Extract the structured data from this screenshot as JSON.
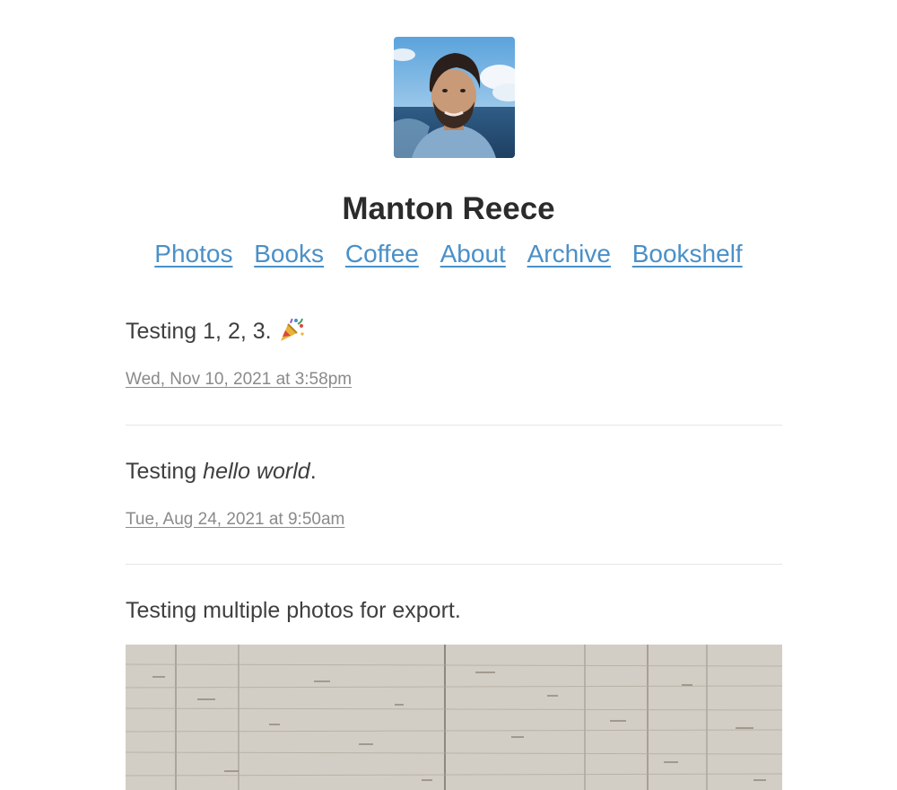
{
  "site": {
    "title": "Manton Reece",
    "avatar_icon": "avatar-photo"
  },
  "nav": {
    "items": [
      {
        "label": "Photos"
      },
      {
        "label": "Books"
      },
      {
        "label": "Coffee"
      },
      {
        "label": "About"
      },
      {
        "label": "Archive"
      },
      {
        "label": "Bookshelf"
      }
    ]
  },
  "colors": {
    "link": "#4a90c8",
    "text": "#3f3f3f",
    "date": "#8a8a8a",
    "divider": "#e6e6e6"
  },
  "posts": [
    {
      "text": "Testing 1, 2, 3.",
      "emoji_icon": "party-popper-icon",
      "date": "Wed, Nov 10, 2021 at 3:58pm"
    },
    {
      "text_prefix": "Testing ",
      "text_em": "hello world",
      "text_suffix": ".",
      "date": "Tue, Aug 24, 2021 at 9:50am"
    },
    {
      "text": "Testing multiple photos for export.",
      "photo_icon": "travertine-wall-photo"
    }
  ]
}
